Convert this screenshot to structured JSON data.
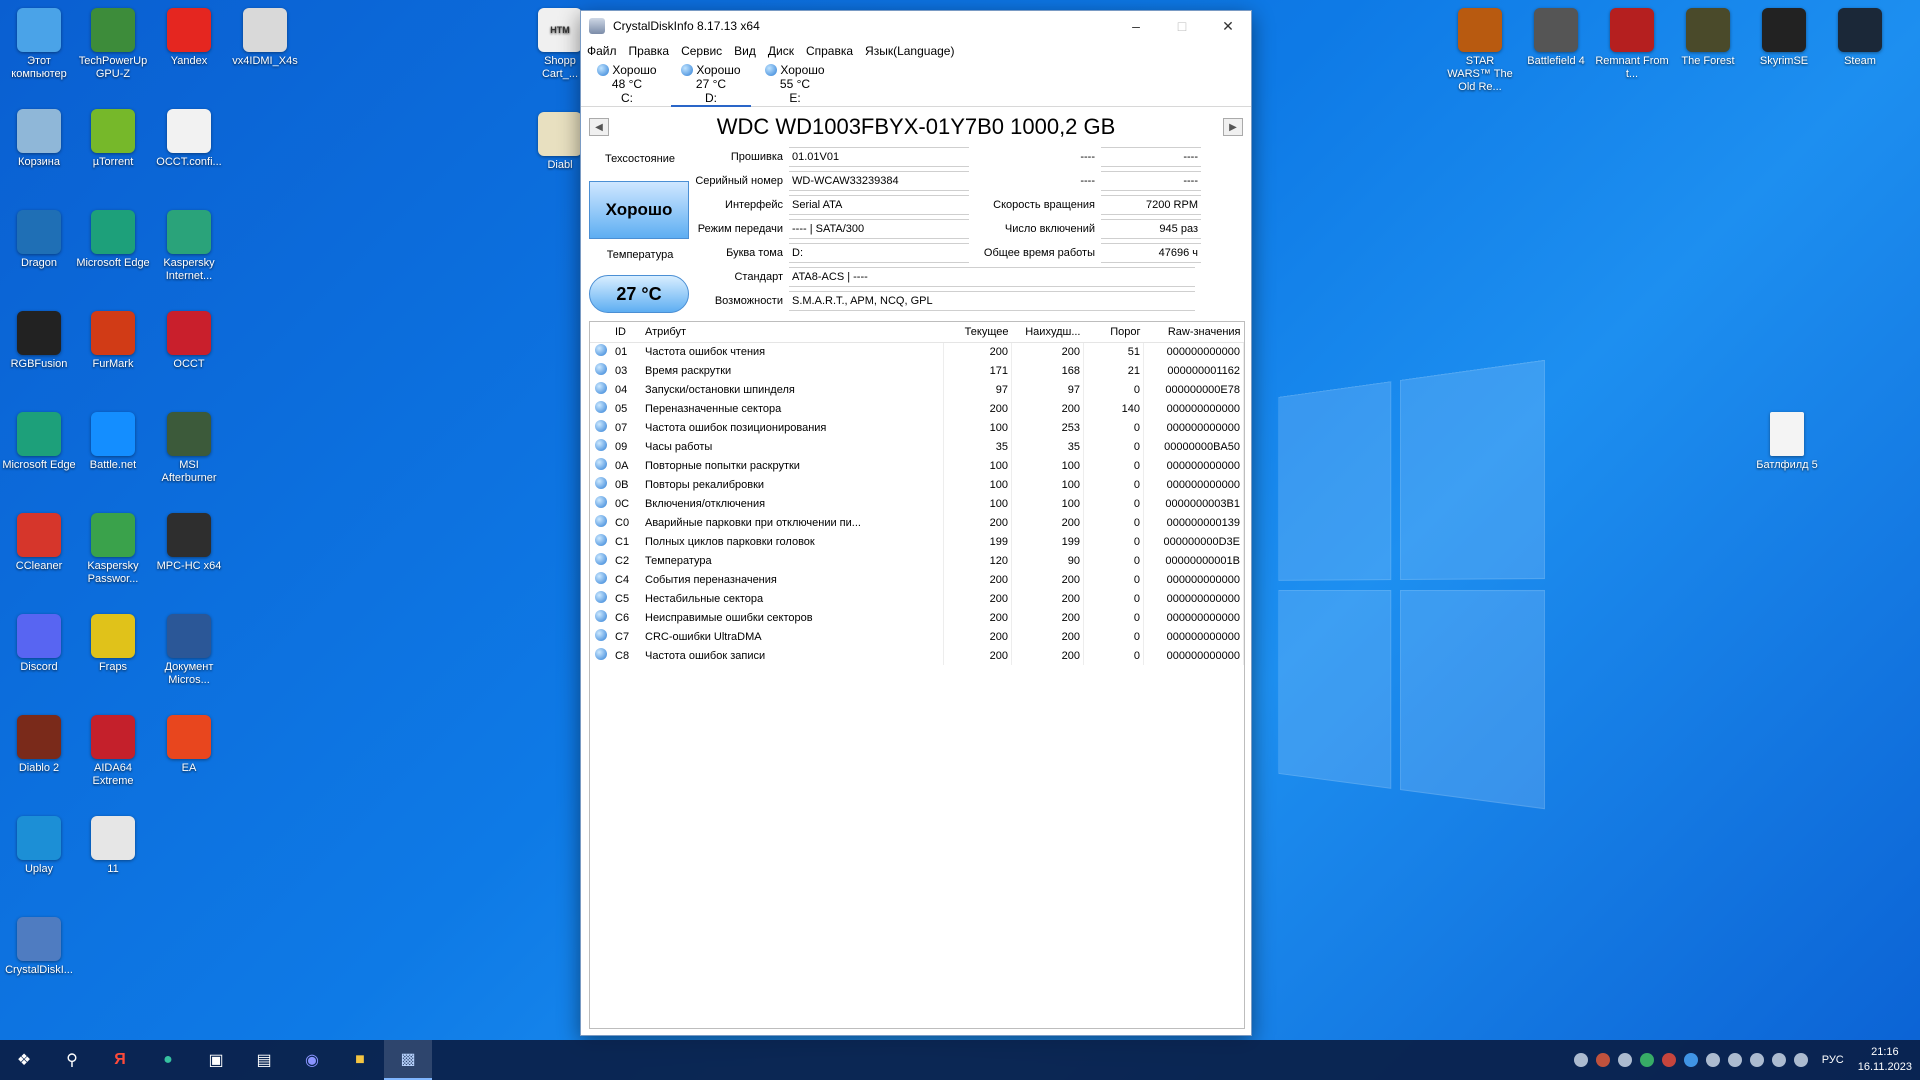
{
  "desktop": {
    "left_icons": [
      {
        "label": "Этот компьютер",
        "icon": "computer-icon",
        "color": "#4aa3e8"
      },
      {
        "label": "TechPowerUp GPU-Z",
        "icon": "gpuz-icon",
        "color": "#3d8c3a"
      },
      {
        "label": "Yandex",
        "icon": "yandex-icon",
        "color": "#e52620"
      },
      {
        "label": "vx4IDMI_X4s",
        "icon": "file-icon",
        "color": "#d9d9d9"
      },
      {
        "label": "Корзина",
        "icon": "recycle-bin-icon",
        "color": "#8fb7d8"
      },
      {
        "label": "µTorrent",
        "icon": "utorrent-icon",
        "color": "#76b82a"
      },
      {
        "label": "OCCT.confi...",
        "icon": "file-icon",
        "color": "#f2f2f2"
      },
      {
        "label": "Dragon",
        "icon": "dragon-icon",
        "color": "#1f6fb5"
      },
      {
        "label": "Microsoft Edge",
        "icon": "edge-icon",
        "color": "#1da07a"
      },
      {
        "label": "Kaspersky Internet...",
        "icon": "kaspersky-icon",
        "color": "#2aa37a"
      },
      {
        "label": "RGBFusion",
        "icon": "rgbfusion-icon",
        "color": "#222222"
      },
      {
        "label": "FurMark",
        "icon": "furmark-icon",
        "color": "#d13b16"
      },
      {
        "label": "OCCT",
        "icon": "occt-icon",
        "color": "#c91f2c"
      },
      {
        "label": "Microsoft Edge",
        "icon": "edge-icon",
        "color": "#1da07a"
      },
      {
        "label": "Battle.net",
        "icon": "battlenet-icon",
        "color": "#148eff"
      },
      {
        "label": "MSI Afterburner",
        "icon": "afterburner-icon",
        "color": "#3c5a3a"
      },
      {
        "label": "CCleaner",
        "icon": "ccleaner-icon",
        "color": "#d6362b"
      },
      {
        "label": "Kaspersky Passwor...",
        "icon": "kaspersky-password-icon",
        "color": "#3aa24b"
      },
      {
        "label": "MPC-HC x64",
        "icon": "mpc-icon",
        "color": "#2e2e2e"
      },
      {
        "label": "Discord",
        "icon": "discord-icon",
        "color": "#5865f2"
      },
      {
        "label": "Fraps",
        "icon": "fraps-icon",
        "color": "#e0c21a"
      },
      {
        "label": "Документ Micros...",
        "icon": "word-doc-icon",
        "color": "#2b5797"
      },
      {
        "label": "Diablo 2",
        "icon": "diablo2-icon",
        "color": "#7a2a1a"
      },
      {
        "label": "AIDA64 Extreme",
        "icon": "aida64-icon",
        "color": "#c4202b"
      },
      {
        "label": "EA",
        "icon": "ea-icon",
        "color": "#e8461e"
      },
      {
        "label": "Uplay",
        "icon": "uplay-icon",
        "color": "#1c8fd6"
      },
      {
        "label": "11",
        "icon": "folder-icon",
        "color": "#e6e6e6"
      },
      {
        "label": "CrystalDiskI...",
        "icon": "crystaldiskinfo-icon",
        "color": "#4f7cc1"
      }
    ],
    "peek_icons": [
      {
        "label": "Shopp Cart_...",
        "icon": "html-file-icon"
      },
      {
        "label": "Diabl",
        "icon": "diablo-icon"
      }
    ],
    "right_icons": [
      {
        "label": "STAR WARS™ The Old Re...",
        "icon": "swtor-icon",
        "color": "#b85a10"
      },
      {
        "label": "Battlefield 4",
        "icon": "battlefield4-icon",
        "color": "#555555"
      },
      {
        "label": "Remnant From t...",
        "icon": "remnant-icon",
        "color": "#b51f1f"
      },
      {
        "label": "The Forest",
        "icon": "the-forest-icon",
        "color": "#4a4a2a"
      },
      {
        "label": "SkyrimSE",
        "icon": "skyrim-icon",
        "color": "#222222"
      },
      {
        "label": "Steam",
        "icon": "steam-icon",
        "color": "#1b2838"
      }
    ],
    "file_icon": {
      "label": "Батлфилд 5",
      "icon": "file-icon"
    }
  },
  "window": {
    "title": "CrystalDiskInfo 8.17.13 x64",
    "menu": [
      "Файл",
      "Правка",
      "Сервис",
      "Вид",
      "Диск",
      "Справка",
      "Язык(Language)"
    ],
    "drives": [
      {
        "status": "Хорошо",
        "temp": "48 °C",
        "letter": "C:"
      },
      {
        "status": "Хорошо",
        "temp": "27 °C",
        "letter": "D:"
      },
      {
        "status": "Хорошо",
        "temp": "55 °C",
        "letter": "E:"
      }
    ],
    "disk_title": "WDC WD1003FBYX-01Y7B0 1000,2 GB",
    "health_label": "Техсостояние",
    "health_value": "Хорошо",
    "temp_label": "Температура",
    "temp_value": "27 °C",
    "fields": {
      "firmware": {
        "label": "Прошивка",
        "value": "01.01V01"
      },
      "serial": {
        "label": "Серийный номер",
        "value": "WD-WCAW33239384"
      },
      "interface": {
        "label": "Интерфейс",
        "value": "Serial ATA"
      },
      "transfer": {
        "label": "Режим передачи",
        "value": "---- | SATA/300"
      },
      "volume": {
        "label": "Буква тома",
        "value": "D:"
      },
      "standard": {
        "label": "Стандарт",
        "value": "ATA8-ACS | ----"
      },
      "features": {
        "label": "Возможности",
        "value": "S.M.A.R.T., APM, NCQ, GPL"
      },
      "right1": {
        "label": "----",
        "value": "----"
      },
      "right2": {
        "label": "----",
        "value": "----"
      },
      "rotation": {
        "label": "Скорость вращения",
        "value": "7200 RPM"
      },
      "power_count": {
        "label": "Число включений",
        "value": "945 раз"
      },
      "power_hours": {
        "label": "Общее время работы",
        "value": "47696 ч"
      }
    },
    "smart_headers": [
      "",
      "ID",
      "Атрибут",
      "Текущее",
      "Наихудш...",
      "Порог",
      "Raw-значения"
    ],
    "smart_rows": [
      [
        "01",
        "Частота ошибок чтения",
        "200",
        "200",
        "51",
        "000000000000"
      ],
      [
        "03",
        "Время раскрутки",
        "171",
        "168",
        "21",
        "000000001162"
      ],
      [
        "04",
        "Запуски/остановки шпинделя",
        "97",
        "97",
        "0",
        "000000000E78"
      ],
      [
        "05",
        "Переназначенные сектора",
        "200",
        "200",
        "140",
        "000000000000"
      ],
      [
        "07",
        "Частота ошибок позиционирования",
        "100",
        "253",
        "0",
        "000000000000"
      ],
      [
        "09",
        "Часы работы",
        "35",
        "35",
        "0",
        "00000000BA50"
      ],
      [
        "0A",
        "Повторные попытки раскрутки",
        "100",
        "100",
        "0",
        "000000000000"
      ],
      [
        "0B",
        "Повторы рекалибровки",
        "100",
        "100",
        "0",
        "000000000000"
      ],
      [
        "0C",
        "Включения/отключения",
        "100",
        "100",
        "0",
        "0000000003B1"
      ],
      [
        "C0",
        "Аварийные парковки при отключении пи...",
        "200",
        "200",
        "0",
        "000000000139"
      ],
      [
        "C1",
        "Полных циклов парковки головок",
        "199",
        "199",
        "0",
        "000000000D3E"
      ],
      [
        "C2",
        "Температура",
        "120",
        "90",
        "0",
        "00000000001B"
      ],
      [
        "C4",
        "События переназначения",
        "200",
        "200",
        "0",
        "000000000000"
      ],
      [
        "C5",
        "Нестабильные сектора",
        "200",
        "200",
        "0",
        "000000000000"
      ],
      [
        "C6",
        "Неисправимые ошибки секторов",
        "200",
        "200",
        "0",
        "000000000000"
      ],
      [
        "C7",
        "CRC-ошибки UltraDMA",
        "200",
        "200",
        "0",
        "000000000000"
      ],
      [
        "C8",
        "Частота ошибок записи",
        "200",
        "200",
        "0",
        "000000000000"
      ]
    ]
  },
  "taskbar": {
    "apps": [
      "start-icon",
      "search-icon",
      "yandex-browser-icon",
      "edge-icon",
      "app-icon",
      "notepad-icon",
      "discord-icon",
      "explorer-icon",
      "crystaldiskinfo-icon"
    ],
    "lang": "РУС",
    "time": "21:16",
    "date": "16.11.2023"
  }
}
